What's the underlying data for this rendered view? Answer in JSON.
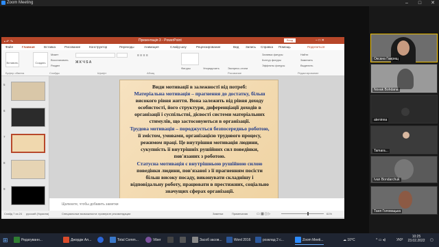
{
  "zoom": {
    "title": "Zoom Meeting"
  },
  "powerpoint": {
    "window_title": "Презентація 3  -  PowerPoint",
    "enter_label": "Вход",
    "tabs": [
      "Файл",
      "Главная",
      "Вставка",
      "Рисование",
      "Конструктор",
      "Переходы",
      "Анимация",
      "Слайд-шоу",
      "Рецензирование",
      "Вид",
      "Запись",
      "Справка",
      "Помощь",
      "Поделиться"
    ],
    "ribbon": {
      "groups": [
        "Буфер обмена",
        "Слайды",
        "Шрифт",
        "Абзац",
        "Рисование",
        "Редактирование"
      ],
      "commands": [
        "Вставить",
        "Создать слайд",
        "Макет",
        "Восстановить",
        "Раздел",
        "Фигуры",
        "Упорядочить",
        "Экспресс-стили",
        "Заливка фигуры",
        "Контур фигуры",
        "Эффекты фигуры",
        "Найти",
        "Заменить",
        "Выделить"
      ]
    },
    "slide_numbers": [
      "5",
      "6",
      "7",
      "8",
      "9"
    ],
    "slide_lines": [
      "Види мотивації в залежності від потреб:",
      "Матеріальна мотивація – прагнення до достатку, більш",
      "високого рівня життя. Вона залежить від рівня доходу",
      "особистості, його структури, диференціації доходів в",
      "організації і суспільстві, дієвості системи матеріальних",
      "стимулів, що застосовуються в організації.",
      "Трудова мотивація – породжується безпосередньо роботою,",
      "її змістом, умовами, організацією трудового процесу,",
      "режимом праці. Це внутрішня мотивація людини,",
      "сукупність її внутрішніх рушійних сил поведінки,",
      "пов'язаних з роботою.",
      "Статусна мотивація є внутрішньою рушійною силою",
      "поведінки людини, пов'язаної з її прагненням посісти",
      "більш високу посаду, виконувати складнішу і",
      "відповідальну роботу, працювати в престижних, соціально",
      "значущих сферах організації."
    ],
    "notes_placeholder": "Щелкните, чтобы добавить заметки",
    "status": {
      "slide": "Слайд 7 из 24",
      "lang": "русский (Украина)",
      "accessibility": "Специальные возможности: проверьте рекомендации",
      "notes": "Заметки",
      "comments": "Примечания",
      "zoom": "61%"
    }
  },
  "participants": [
    {
      "name": "Оксана Гаврищ"
    },
    {
      "name": "Novak Bohdana"
    },
    {
      "name": "ateninna"
    },
    {
      "name": "Tamara..."
    },
    {
      "name": "Ivan Bondarchuk"
    },
    {
      "name": "Таня Головацька"
    }
  ],
  "taskbar": {
    "apps": [
      "Редагуванн...",
      "Джордж Ал...",
      "",
      "Total Comm...",
      "Viber",
      "",
      "",
      "Засоб засов...",
      "Word 2016",
      "розклад 2 с...",
      "Zoom Meeti..."
    ],
    "weather": "10°C",
    "lang": "УКР",
    "time": "10:25",
    "date": "23.02.2022"
  },
  "colors": {
    "ppt_accent": "#b7472a",
    "slide_bg": "#f5deb5",
    "blue_text": "#1f3a8a",
    "taskbar": "#1f2532"
  }
}
